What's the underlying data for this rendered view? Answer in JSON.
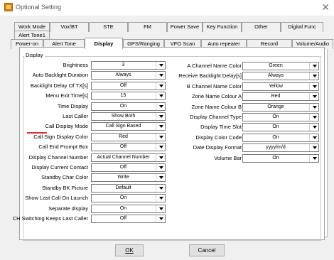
{
  "window": {
    "title": "Optional Setting",
    "close_glyph": "✕"
  },
  "tabs_row1": [
    "Work Mode",
    "Vox/BT",
    "STE",
    "FM",
    "Power Save",
    "Key Function",
    "Other",
    "Digital Func"
  ],
  "tabs_row2": [
    "Alert Tone1"
  ],
  "tabs_row3": [
    "Power-on",
    "Alert Tone",
    "Display",
    "GPS/Ranging",
    "VFO Scan",
    "Auto repeater",
    "Record",
    "Volume/Audio"
  ],
  "active_tab": "Display",
  "group": {
    "title": "Display"
  },
  "left_fields": [
    {
      "label": "Brightness",
      "value": "3"
    },
    {
      "label": "Auto Backlight Duration",
      "value": "Always"
    },
    {
      "label": "Backlight Delay Of TX[s]",
      "value": "Off"
    },
    {
      "label": "Menu Exit Time[s]",
      "value": "15"
    },
    {
      "label": "Time Display",
      "value": "On"
    },
    {
      "label": "Last Caller",
      "value": "Show Both"
    },
    {
      "label": "Call Display Mode",
      "value": "Call Sign Based"
    },
    {
      "label": "Call Sign Display Color",
      "value": "Red"
    },
    {
      "label": "Call End Prompt Box",
      "value": "Off"
    },
    {
      "label": "Display Channel Number",
      "value": "Actual Channel Number"
    },
    {
      "label": "Display Current Contact",
      "value": "Off"
    },
    {
      "label": "Standby Char Color",
      "value": "Write"
    },
    {
      "label": "Standby BK Picture",
      "value": "Default"
    },
    {
      "label": "Show Last Call On Launch",
      "value": "On"
    },
    {
      "label": "Separate display",
      "value": "On"
    },
    {
      "label": "CH Switching Keeps Last Caller",
      "value": "Off"
    }
  ],
  "right_fields": [
    {
      "label": "A Channel Name Color",
      "value": "Green"
    },
    {
      "label": "Receive Backlight Delay[s]",
      "value": "Always"
    },
    {
      "label": "B Channel Name Color",
      "value": "Yellow"
    },
    {
      "label": "Zone Name Colour A",
      "value": "Red"
    },
    {
      "label": "Zone Name Colour B",
      "value": "Orange"
    },
    {
      "label": "Display Channel Type",
      "value": "On"
    },
    {
      "label": "Display Time Slot",
      "value": "On"
    },
    {
      "label": "Display Color Code",
      "value": "On"
    },
    {
      "label": "Date Display Format",
      "value": "yyyy/m/d"
    },
    {
      "label": "Volume Bar",
      "value": "On"
    }
  ],
  "buttons": {
    "ok": "OK",
    "cancel": "Cancel"
  },
  "colors": {
    "highlight_line": "#e03030",
    "app_icon": "#e07a10"
  }
}
